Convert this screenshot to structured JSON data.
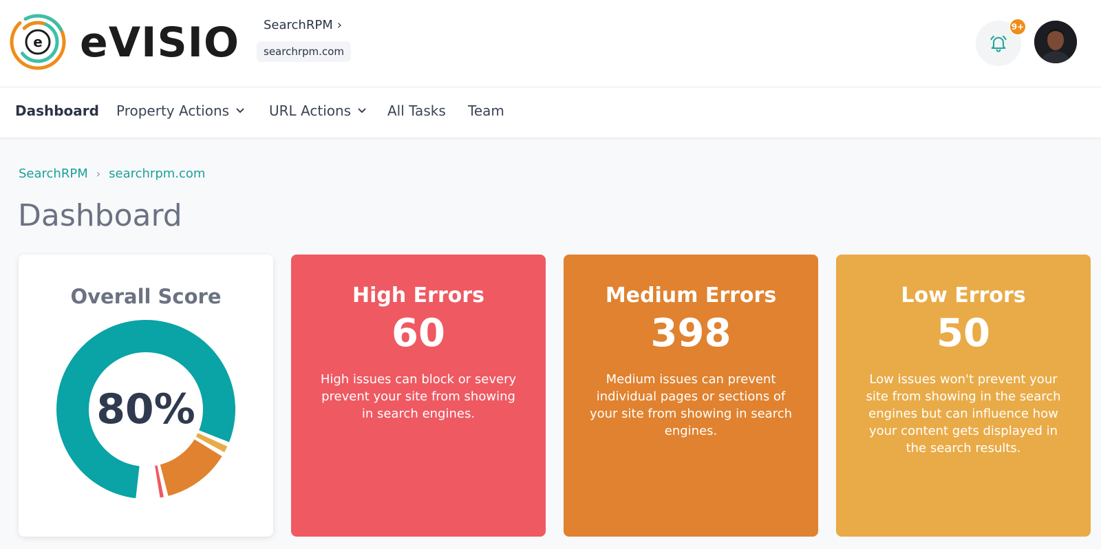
{
  "brand": {
    "wordmark": "eVISIO",
    "logo_letter": "e"
  },
  "header": {
    "org_name": "SearchRPM",
    "org_chevron": "›",
    "domain": "searchrpm.com",
    "notifications_badge": "9+"
  },
  "nav": {
    "items": [
      {
        "label": "Dashboard",
        "active": true
      },
      {
        "label": "Property Actions",
        "dropdown": true
      },
      {
        "label": "URL Actions",
        "dropdown": true
      },
      {
        "label": "All Tasks"
      },
      {
        "label": "Team"
      }
    ],
    "dropdown_icon": "⌄"
  },
  "breadcrumb": {
    "items": [
      "SearchRPM",
      "searchrpm.com"
    ],
    "separator": "›"
  },
  "page": {
    "title": "Dashboard"
  },
  "score_card": {
    "title": "Overall Score",
    "value": "80%",
    "segments": [
      {
        "label": "score",
        "percent": 80,
        "color": "#0aa3a6"
      },
      {
        "label": "low",
        "percent": 2,
        "color": "#e9ab47"
      },
      {
        "label": "medium",
        "percent": 13,
        "color": "#e0822f"
      },
      {
        "label": "high",
        "percent": 1.5,
        "color": "#ef5962"
      }
    ]
  },
  "error_cards": [
    {
      "title": "High Errors",
      "value": "60",
      "description": "High issues can block or severy prevent your site from showing in search engines.",
      "color": "#ef5962"
    },
    {
      "title": "Medium Errors",
      "value": "398",
      "description": "Medium issues can prevent individual pages or sections of your site from showing in search engines.",
      "color": "#e0822f"
    },
    {
      "title": "Low Errors",
      "value": "50",
      "description": "Low issues won't prevent your site from showing in the search engines but can influence how your content gets displayed in the search results.",
      "color": "#e9ab47"
    }
  ]
}
